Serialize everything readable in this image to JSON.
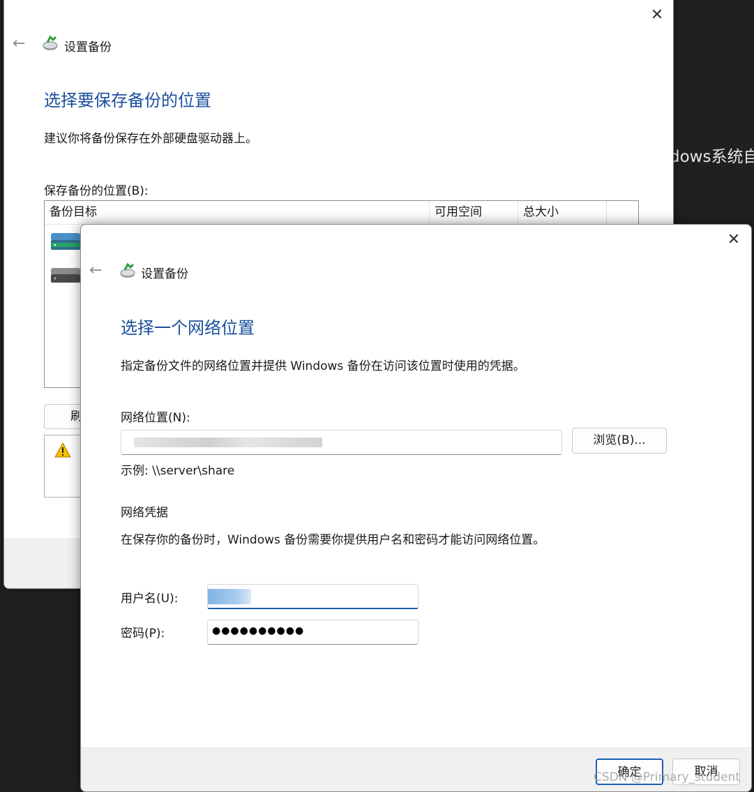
{
  "background": {
    "text": "dows系统自"
  },
  "back_window": {
    "title": "设置备份",
    "heading": "选择要保存备份的位置",
    "description": "建议你将备份保存在外部硬盘驱动器上。",
    "location_label": "保存备份的位置(B):",
    "columns": [
      "备份目标",
      "可用空间",
      "总大小"
    ],
    "refresh_label": "刷"
  },
  "front_window": {
    "title": "设置备份",
    "heading": "选择一个网络位置",
    "description": "指定备份文件的网络位置并提供 Windows 备份在访问该位置时使用的凭据。",
    "network_location_label": "网络位置(N):",
    "browse_label": "浏览(B)...",
    "example": "示例: \\\\server\\share",
    "credentials_heading": "网络凭据",
    "credentials_desc": "在保存你的备份时，Windows 备份需要你提供用户名和密码才能访问网络位置。",
    "username_label": "用户名(U):",
    "password_label": "密码(P):",
    "password_value": "●●●●●●●●●●",
    "ok_label": "确定",
    "cancel_label": "取消"
  },
  "watermark": "CSDN @Primary_student",
  "colors": {
    "heading": "#1b4f9c",
    "accent_underline": "#1a5fb4"
  }
}
